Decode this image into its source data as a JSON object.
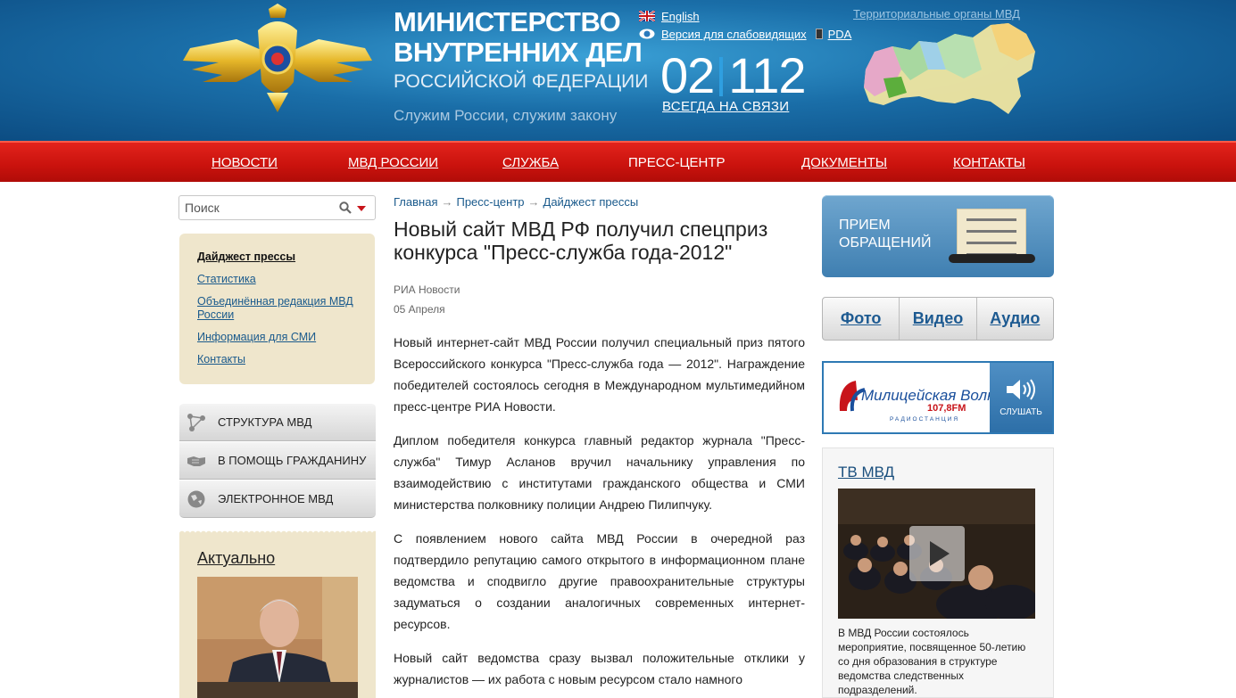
{
  "header": {
    "title_line1": "МИНИСТЕРСТВО",
    "title_line2": "ВНУТРЕННИХ ДЕЛ",
    "title_line3": "РОССИЙСКОЙ ФЕДЕРАЦИИ",
    "slogan": "Служим России, служим закону",
    "lang_english": "English",
    "low_vision": "Версия для слабовидящих",
    "pda": "PDA",
    "phone_left": "02",
    "phone_right": "112",
    "phone_caption": "ВСЕГДА НА СВЯЗИ",
    "territorial": "Территориальные органы МВД"
  },
  "nav": {
    "items": [
      "НОВОСТИ",
      "МВД РОССИИ",
      "СЛУЖБА",
      "ПРЕСС-ЦЕНТР",
      "ДОКУМЕНТЫ",
      "КОНТАКТЫ"
    ]
  },
  "search": {
    "placeholder": "Поиск"
  },
  "submenu": {
    "items": [
      "Дайджест прессы",
      "Статистика",
      "Объединённая редакция МВД России",
      "Информация для СМИ",
      "Контакты"
    ]
  },
  "blocks": {
    "items": [
      "СТРУКТУРА МВД",
      "В ПОМОЩЬ ГРАЖДАНИНУ",
      "ЭЛЕКТРОННОЕ МВД"
    ]
  },
  "actual": {
    "title": "Актуально"
  },
  "breadcrumb": {
    "items": [
      "Главная",
      "Пресс-центр",
      "Дайджест прессы"
    ],
    "separator": "→"
  },
  "article": {
    "title": "Новый сайт МВД РФ получил спецприз конкурса \"Пресс-служба года-2012\"",
    "source": "РИА Новости",
    "date": "05 Апреля",
    "paragraphs": [
      "Новый интернет-сайт МВД России получил специальный приз пятого Всероссийского конкурса \"Пресс-служба года — 2012\". Награждение победителей состоялось сегодня в Международном мультимедийном пресс-центре РИА Новости.",
      "Диплом победителя конкурса главный редактор журнала \"Пресс-служба\" Тимур Асланов вручил начальнику управления по взаимодействию с институтами гражданского общества и СМИ министерства полковнику полиции Андрею Пилипчуку.",
      "С появлением нового сайта МВД России в очередной раз подтвердило репутацию самого открытого в информационном плане ведомства и сподвигло другие правоохранительные структуры задуматься о создании аналогичных современных интернет-ресурсов.",
      "Новый сайт ведомства сразу вызвал положительные отклики у журналистов — их работа с новым ресурсом стало намного"
    ]
  },
  "right": {
    "appeal_line1": "ПРИЕМ",
    "appeal_line2": "ОБРАЩЕНИЙ",
    "media": [
      "Фото",
      "Видео",
      "Аудио"
    ],
    "radio_name": "Милицейская Волна",
    "radio_freq": "107,8FM",
    "radio_sub": "РАДИОСТАНЦИЯ",
    "listen": "СЛУШАТЬ",
    "tv_title": "ТВ МВД",
    "tv_caption": "В МВД России состоялось мероприятие, посвященное 50-летию со дня образования в структуре ведомства следственных подразделений."
  },
  "colors": {
    "header_blue": "#1a6ea8",
    "nav_red": "#c9120d",
    "link": "#1a5a8c",
    "panel_beige": "#efe6cc"
  }
}
